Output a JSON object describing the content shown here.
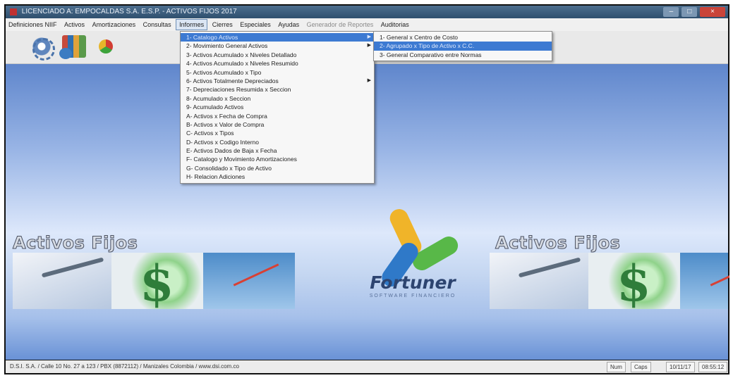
{
  "window": {
    "title": "LICENCIADO A: EMPOCALDAS S.A. E.S.P. - ACTIVOS FIJOS 2017",
    "controls": [
      "–",
      "□",
      "×"
    ]
  },
  "menubar": {
    "items": [
      {
        "label": "Definiciones NIIF",
        "state": "normal"
      },
      {
        "label": "Activos",
        "state": "normal"
      },
      {
        "label": "Amortizaciones",
        "state": "normal"
      },
      {
        "label": "Consultas",
        "state": "normal"
      },
      {
        "label": "Informes",
        "state": "active"
      },
      {
        "label": "Cierres",
        "state": "normal"
      },
      {
        "label": "Especiales",
        "state": "normal"
      },
      {
        "label": "Ayudas",
        "state": "normal"
      },
      {
        "label": "Generador de Reportes",
        "state": "dim"
      },
      {
        "label": "Auditorias",
        "state": "normal"
      }
    ]
  },
  "toolbar": {
    "icons": [
      "gear-icon",
      "books-icon",
      "refresh-icon"
    ]
  },
  "informes_menu": {
    "items": [
      {
        "label": "1- Catalogo Activos",
        "submenu": true,
        "highlighted": true
      },
      {
        "label": "2- Movimiento General Activos",
        "submenu": true
      },
      {
        "label": "3- Activos Acumulado x Niveles Detallado"
      },
      {
        "label": "4- Activos Acumulado x Niveles Resumido"
      },
      {
        "label": "5- Activos Acumulado x Tipo"
      },
      {
        "label": "6- Activos Totalmente Depreciados",
        "submenu": true
      },
      {
        "label": "7- Depreciaciones Resumida x Seccion"
      },
      {
        "label": "8- Acumulado x Seccion"
      },
      {
        "label": "9- Acumulado Activos"
      },
      {
        "label": "A- Activos x Fecha de Compra"
      },
      {
        "label": "B- Activos x Valor de Compra"
      },
      {
        "label": "C- Activos x Tipos"
      },
      {
        "label": "D- Activos x Codigo Interno"
      },
      {
        "label": "E- Activos Dados de Baja x Fecha"
      },
      {
        "label": "F- Catalogo y Movimiento Amortizaciones"
      },
      {
        "label": "G- Consolidado x Tipo de Activo"
      },
      {
        "label": "H- Relacion Adiciones"
      }
    ],
    "submenu_arrow": "▶"
  },
  "catalogo_submenu": {
    "items": [
      {
        "label": "1- General x Centro de Costo",
        "highlighted": false
      },
      {
        "label": "2- Agrupado x Tipo de Activo x C.C.",
        "highlighted": true
      },
      {
        "label": "3- General Comparativo entre Normas",
        "highlighted": false
      }
    ]
  },
  "desktop": {
    "brand_left": "Activos Fijos",
    "brand_right": "Activos Fijos",
    "logo_name": "Fortuner",
    "logo_tagline": "SOFTWARE FINANCIERO"
  },
  "statusbar": {
    "company": "D.S.I. S.A. / Calle 10 No. 27 a 123 / PBX (8872112) / Manizales Colombia / www.dsi.com.co",
    "num": "Num",
    "caps": "Caps",
    "date": "10/11/17",
    "time": "08:55:12"
  },
  "colors": {
    "titlebar": "#2f4f6e",
    "menu_highlight": "#3d7ad2",
    "desktop_sky": "#7aa0dd",
    "logo_yellow": "#f0b429",
    "logo_green": "#58b848",
    "logo_blue": "#2f79c8"
  }
}
